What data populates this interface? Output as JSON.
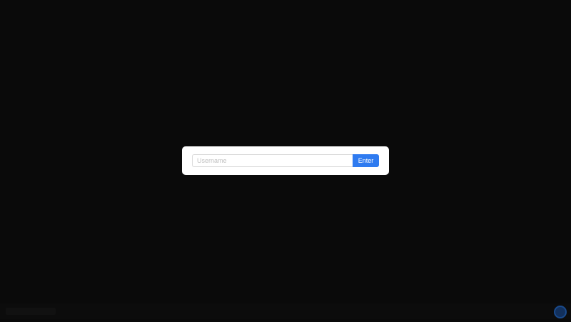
{
  "login": {
    "username_placeholder": "Username",
    "username_value": "",
    "enter_label": "Enter"
  },
  "colors": {
    "background": "#0a0a0a",
    "card": "#ffffff",
    "accent": "#2f7bf0"
  }
}
